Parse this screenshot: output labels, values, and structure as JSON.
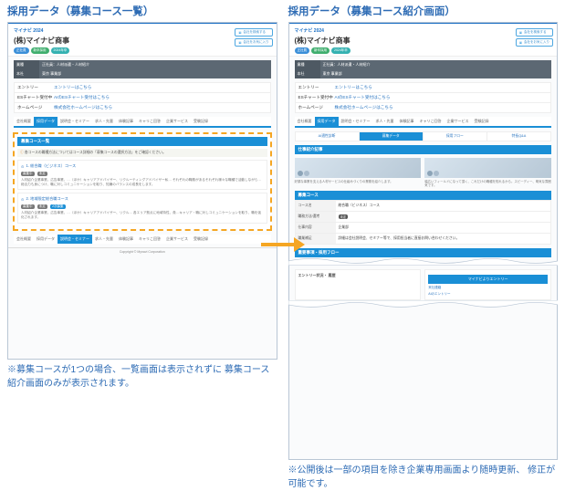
{
  "left": {
    "title": "採用データ（募集コース一覧）",
    "logo": "マイナビ 2024",
    "company": "(株)マイナビ商事",
    "pills": [
      "正社員",
      "新卒採用",
      "2024年卒"
    ],
    "top_buttons": {
      "b1": "会社を検索する",
      "b2": "会社をお気に入り"
    },
    "dark": [
      {
        "lab": "業種",
        "val": "正社員：人材派遣・人材紹介"
      },
      {
        "lab": "本社",
        "val": "東京 事業部"
      }
    ],
    "links": [
      {
        "lab": "エントリー",
        "val": "エントリーはこちら"
      },
      {
        "lab": "ESチャート受付中",
        "val": "AIのESチャート受付はこちら"
      },
      {
        "lab": "ホームページ",
        "val": "株式会社ホームページはこちら"
      }
    ],
    "tabs": [
      "会社概要",
      "採用データ",
      "説明会・セミナー",
      "求人・先輩",
      "体験記事",
      "キャリこ回答",
      "企業サービス",
      "受験記録"
    ],
    "tabs_active": 1,
    "bar": "募集コース一覧",
    "alert": "各コースの職種方法についてはコース詳細の「募集コースの選択方法」をご確認ください。",
    "course1": {
      "title": "1. 総合職（ビジネス）コース",
      "tags": [
        "募集中",
        "未定"
      ],
      "body": "人材紹介企業事業、広告事業、…（ほか）キャリアアドバイザー、リクルーティングアドバイザー私… それぞれの職務があるそれぞれ様々な職種で活動しながら…総合力も身につけ、職に対しコミュニケーションを取り、知識のバランスの成長をします。"
    },
    "course2": {
      "title": "2. 地域限定総合職コース",
      "tags": [
        "募集中",
        "未定",
        "2次募集"
      ],
      "body": "人材紹介企業事業、広告事業、…（ほか）キャリアアドバイザー、リクル… 各エリア拠点に地域特性、貴…キャリア・職に対しコミュニケーションを取り、職を強化されます。"
    },
    "footer": "Copyright © Mynavi Corporation",
    "note": "※募集コースが1つの場合、一覧画面は表示されずに\n募集コース紹介画面のみが表示されます。"
  },
  "right": {
    "title": "採用データ（募集コース紹介画面）",
    "subtabs": [
      "AI適性診断",
      "募集データ",
      "採用フロー",
      "特長Q&A"
    ],
    "subtabs_active": 1,
    "bar_work": "仕事紹介記事",
    "caption1": "好調な事業を支える人材サービスの仕組みづくりの業務を紹介します。",
    "caption2": "幅広いフィールドになって頂く、これだけの職種を知れるから。スピーディー、明気な雰囲気です。",
    "bar_course": "募集コース",
    "detail": [
      {
        "lab": "コース名",
        "val": "総合職（ビジネス）コース"
      },
      {
        "lab": "職務方法/選考",
        "val": "未定"
      },
      {
        "lab": "仕事内容",
        "val": "企業部"
      },
      {
        "lab": "職業補足",
        "val": "詳細は会社説明会、セミナー等で、採用担当者に直接お問い合わせください。"
      }
    ],
    "bar_info": "重要事項・採用フロー",
    "entry_label": "エントリー状況・\n履歴",
    "entry_button": "マイナビよりエントリー",
    "entry_link1": "来社連絡",
    "entry_link2": "AIのエントリー",
    "note": "※公開後は一部の項目を除き企業専用画面より随時更新、\n修正が可能です。"
  }
}
